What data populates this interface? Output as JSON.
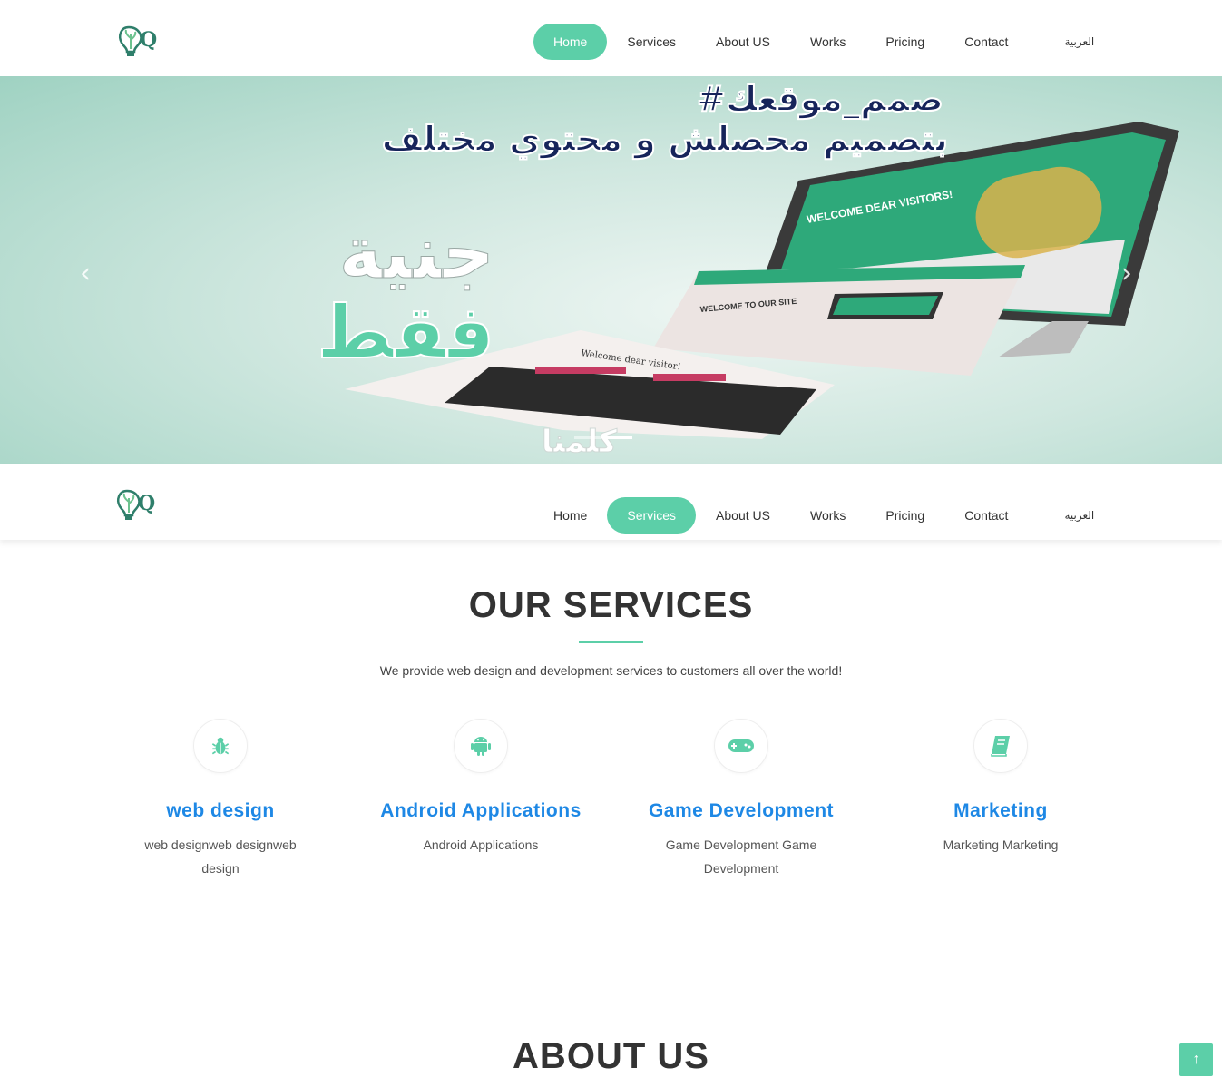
{
  "nav": {
    "items": [
      {
        "label": "Home"
      },
      {
        "label": "Services"
      },
      {
        "label": "About US"
      },
      {
        "label": "Works"
      },
      {
        "label": "Pricing"
      },
      {
        "label": "Contact"
      }
    ],
    "lang": "العربية",
    "brand_color": "#5ccfa8"
  },
  "hero": {
    "headline_1": "#صمم_موقعك",
    "headline_2": "بتصميم محصلش و محتوي مختلف",
    "big_text_1": "جنية",
    "big_text_2": "فقط",
    "cta": "كلمنا",
    "screen_text_1": "WELCOME DEAR VISITORS!",
    "screen_text_2": "WELCOME TO OUR SITE",
    "screen_text_3": "Welcome dear visitor!",
    "prev_icon": "‹",
    "next_icon": "›"
  },
  "services": {
    "title": "OUR SERVICES",
    "subtitle": "We provide web design and development services to customers all over the world!",
    "items": [
      {
        "icon": "bug-icon",
        "title": "web design",
        "desc": "web designweb designweb design"
      },
      {
        "icon": "android-icon",
        "title": "Android Applications",
        "desc": "Android Applications"
      },
      {
        "icon": "gamepad-icon",
        "title": "Game Development",
        "desc": "Game Development Game Development"
      },
      {
        "icon": "book-icon",
        "title": "Marketing",
        "desc": "Marketing Marketing"
      }
    ]
  },
  "about": {
    "title": "ABOUT US"
  },
  "back_to_top": "↑"
}
